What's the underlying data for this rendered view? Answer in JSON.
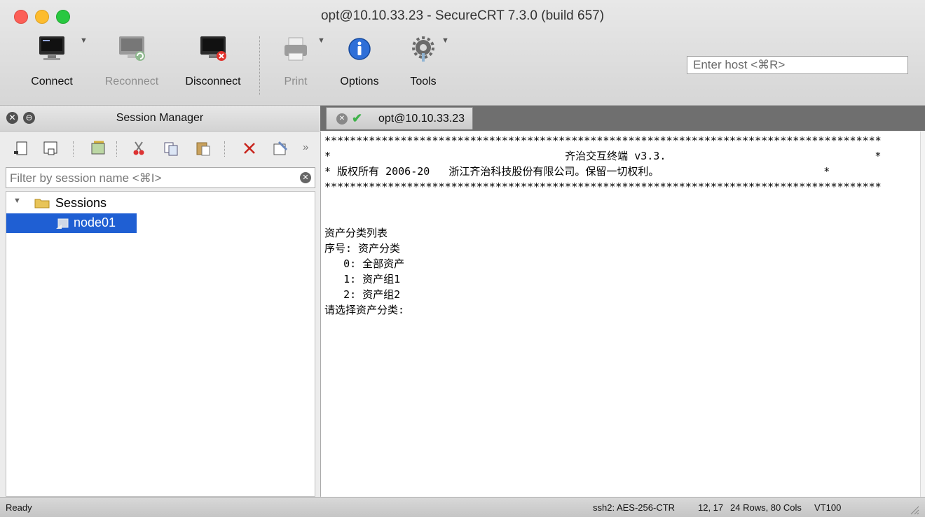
{
  "window": {
    "title": "opt@10.10.33.23 - SecureCRT 7.3.0 (build 657)"
  },
  "toolbar": {
    "connect": "Connect",
    "reconnect": "Reconnect",
    "disconnect": "Disconnect",
    "print": "Print",
    "options": "Options",
    "tools": "Tools",
    "host_placeholder": "Enter host <⌘R>"
  },
  "session_manager": {
    "title": "Session Manager",
    "filter_placeholder": "Filter by session name <⌘I>",
    "tree": {
      "folder": "Sessions",
      "items": [
        "node01"
      ]
    }
  },
  "tab": {
    "label": "opt@10.10.33.23"
  },
  "terminal": {
    "lines": [
      "****************************************************************************************",
      "*                                     齐治交互终端 v3.3.                                 *",
      "* 版权所有 2006-20   浙江齐治科技股份有限公司。保留一切权利。                          *",
      "****************************************************************************************",
      "",
      "",
      "资产分类列表",
      "序号: 资产分类",
      "   0: 全部资产",
      "   1: 资产组1",
      "   2: 资产组2",
      "请选择资产分类:"
    ]
  },
  "status": {
    "left": "Ready",
    "cipher": "ssh2: AES-256-CTR",
    "cursor": "12, 17",
    "size": "24 Rows, 80 Cols",
    "emulation": "VT100"
  }
}
